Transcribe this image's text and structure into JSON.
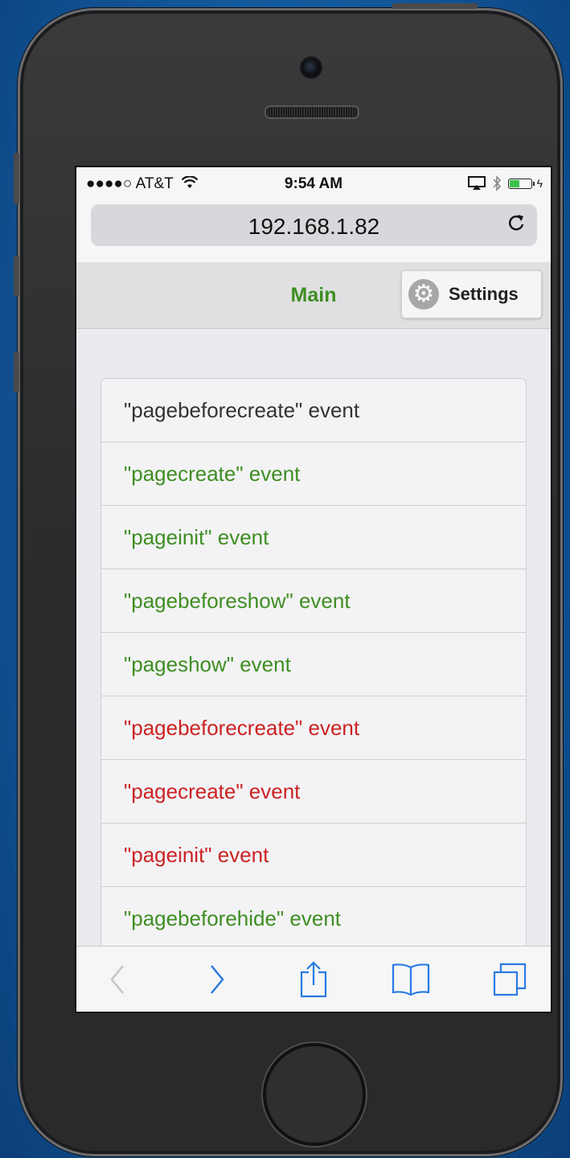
{
  "status_bar": {
    "carrier": "●●●●○ AT&T",
    "time": "9:54 AM"
  },
  "browser": {
    "url": "192.168.1.82",
    "reload_icon": "reload-icon"
  },
  "header": {
    "title": "Main",
    "settings_label": "Settings",
    "title_color": "#3e8e22"
  },
  "events": [
    {
      "label": "\"pagebeforecreate\" event",
      "color": "#333333"
    },
    {
      "label": "\"pagecreate\" event",
      "color": "#3e8e22"
    },
    {
      "label": "\"pageinit\" event",
      "color": "#3e8e22"
    },
    {
      "label": "\"pagebeforeshow\" event",
      "color": "#3e8e22"
    },
    {
      "label": "\"pageshow\" event",
      "color": "#3e8e22"
    },
    {
      "label": "\"pagebeforecreate\" event",
      "color": "#cc2222"
    },
    {
      "label": "\"pagecreate\" event",
      "color": "#cc2222"
    },
    {
      "label": "\"pageinit\" event",
      "color": "#cc2222"
    },
    {
      "label": "\"pagebeforehide\" event",
      "color": "#3e8e22"
    }
  ],
  "toolbar": {
    "icons": [
      "back-icon",
      "forward-icon",
      "share-icon",
      "bookmarks-icon",
      "tabs-icon"
    ],
    "accent": "#2a7ae2"
  }
}
